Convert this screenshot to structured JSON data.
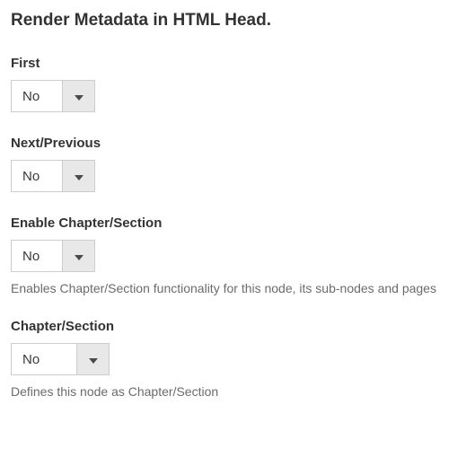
{
  "title": "Render Metadata in HTML Head.",
  "fields": {
    "first": {
      "label": "First",
      "value": "No"
    },
    "next_prev": {
      "label": "Next/Previous",
      "value": "No"
    },
    "enable_chapter": {
      "label": "Enable Chapter/Section",
      "value": "No",
      "help": "Enables Chapter/Section functionality for this node, its sub-nodes and pages"
    },
    "chapter_section": {
      "label": "Chapter/Section",
      "value": "No",
      "help": "Defines this node as Chapter/Section"
    }
  }
}
